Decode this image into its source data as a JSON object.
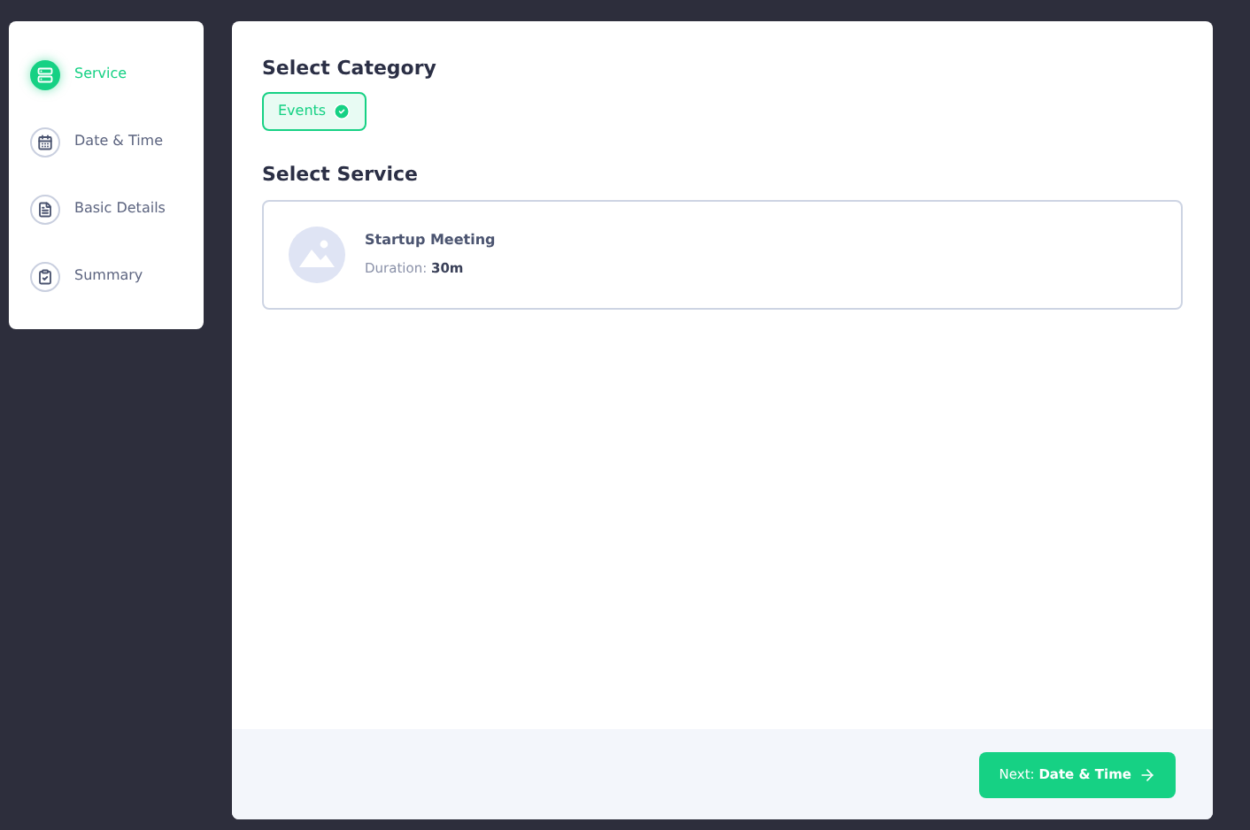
{
  "steps": [
    {
      "label": "Service",
      "kind": "service",
      "selected": true
    },
    {
      "label": "Date & Time",
      "kind": "date",
      "selected": false
    },
    {
      "label": "Basic Details",
      "kind": "details",
      "selected": false
    },
    {
      "label": "Summary",
      "kind": "summary",
      "selected": false
    }
  ],
  "category": {
    "heading": "Select Category",
    "chips": [
      {
        "label": "Events",
        "selected": true
      }
    ]
  },
  "service": {
    "heading": "Select Service",
    "cards": [
      {
        "name": "Startup Meeting",
        "duration": "Duration: **30m**",
        "kind": "picture"
      }
    ]
  },
  "next_button": "Next: **Date & Time**"
}
